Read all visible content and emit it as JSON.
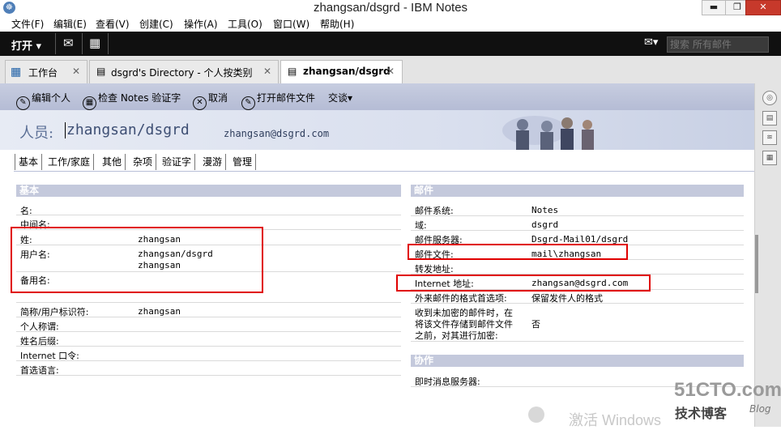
{
  "window": {
    "title": "zhangsan/dsgrd - IBM Notes",
    "minimize": "▬",
    "maximize": "❐",
    "close": "✕"
  },
  "menubar": [
    "文件(F)",
    "编辑(E)",
    "查看(V)",
    "创建(C)",
    "操作(A)",
    "工具(O)",
    "窗口(W)",
    "帮助(H)"
  ],
  "darkbar": {
    "open_label": "打开 ▾",
    "search_placeholder": "搜索 所有邮件"
  },
  "tabs": [
    {
      "label": "工作台",
      "close": "✕"
    },
    {
      "label": "dsgrd's Directory - 个人按类别",
      "close": "✕"
    },
    {
      "label": "zhangsan/dsgrd",
      "close": "✕"
    }
  ],
  "actions": [
    "编辑个人",
    "检查 Notes 验证字",
    "取消",
    "打开邮件文件",
    "交谈▾"
  ],
  "header": {
    "label": "人员:",
    "name": "zhangsan/dsgrd",
    "email": "zhangsan@dsgrd.com"
  },
  "form_tabs": [
    "基本",
    "工作/家庭",
    "其他",
    "杂项",
    "验证字",
    "漫游",
    "管理"
  ],
  "basic": {
    "section": "基本",
    "fields": [
      {
        "label": "名:",
        "value": ""
      },
      {
        "label": "中间名:",
        "value": ""
      },
      {
        "label": "姓:",
        "value": "zhangsan"
      },
      {
        "label": "用户名:",
        "value": "zhangsan/dsgrd",
        "value2": "zhangsan"
      },
      {
        "label": "备用名:",
        "value": ""
      },
      {
        "label": "简称/用户标识符:",
        "value": "zhangsan"
      },
      {
        "label": "个人称谓:",
        "value": ""
      },
      {
        "label": "姓名后缀:",
        "value": ""
      },
      {
        "label": "Internet 口令:",
        "value": ""
      },
      {
        "label": "首选语言:",
        "value": ""
      }
    ]
  },
  "mail": {
    "section": "邮件",
    "fields": [
      {
        "label": "邮件系统:",
        "value": "Notes"
      },
      {
        "label": "域:",
        "value": "dsgrd"
      },
      {
        "label": "邮件服务器:",
        "value": "Dsgrd-Mail01/dsgrd"
      },
      {
        "label": "邮件文件:",
        "value": "mail\\zhangsan"
      },
      {
        "label": "转发地址:",
        "value": ""
      },
      {
        "label": "Internet 地址:",
        "value": "zhangsan@dsgrd.com"
      },
      {
        "label": "外来邮件的格式首选项:",
        "value": "保留发件人的格式"
      },
      {
        "label": "收到未加密的邮件时，在将该文件存储到邮件文件之前，对其进行加密:",
        "line1": "收到未加密的邮件时，在",
        "line2": "将该文件存储到邮件文件",
        "line3": "之前，对其进行加密:",
        "value": "否"
      }
    ]
  },
  "collab": {
    "section": "协作",
    "fields": [
      {
        "label": "即时消息服务器:",
        "value": ""
      }
    ]
  },
  "watermarks": {
    "activate": "激活 Windows",
    "logo": "51CTO.com",
    "sub": "技术博客",
    "blog": "Blog"
  }
}
